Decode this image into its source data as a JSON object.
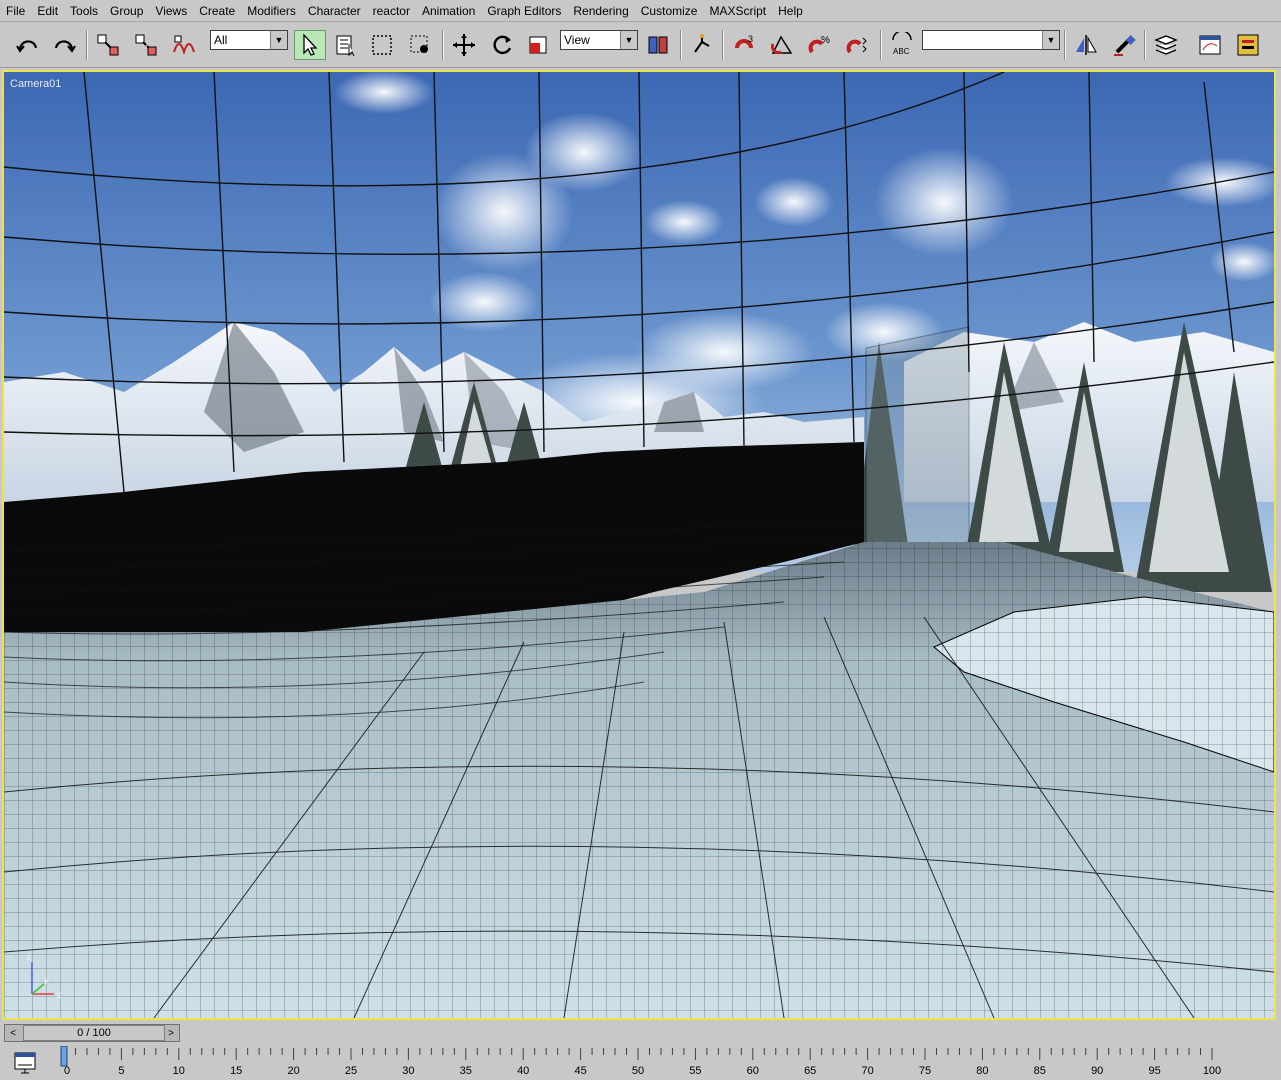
{
  "menu": [
    "File",
    "Edit",
    "Tools",
    "Group",
    "Views",
    "Create",
    "Modifiers",
    "Character",
    "reactor",
    "Animation",
    "Graph Editors",
    "Rendering",
    "Customize",
    "MAXScript",
    "Help"
  ],
  "toolbar": {
    "selection_filter": "All",
    "reference_coord": "View",
    "named_selection": ""
  },
  "viewport": {
    "label": "Camera01",
    "axis": {
      "x": "x",
      "y": "y",
      "z": "z"
    }
  },
  "time_slider": {
    "frame_display": "0 / 100",
    "prev": "<",
    "next": ">"
  },
  "timeline": {
    "ticks": [
      "0",
      "5",
      "10",
      "15",
      "20",
      "25",
      "30",
      "35",
      "40",
      "45",
      "50",
      "55",
      "60",
      "65",
      "70",
      "75",
      "80",
      "85",
      "90",
      "95",
      "100"
    ]
  },
  "colors": {
    "viewport_border": "#f2e24a",
    "sky_top": "#3c68b4",
    "sky_bottom": "#a9c4e4",
    "ground": "#c9dde4",
    "active_button": "#b8e8b8"
  }
}
